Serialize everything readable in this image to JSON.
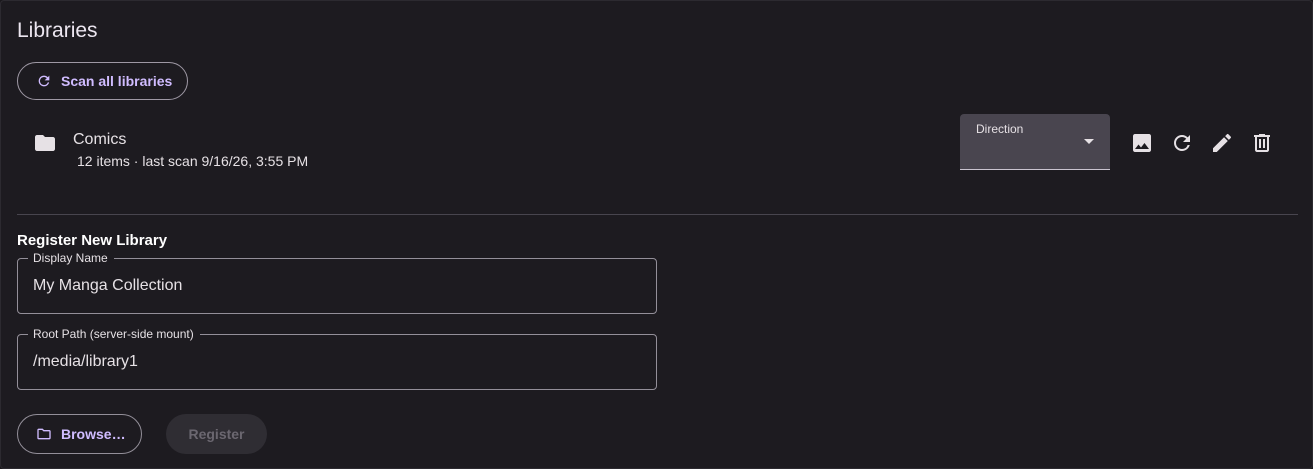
{
  "header": {
    "title": "Libraries"
  },
  "toolbar": {
    "scan_all_label": "Scan all libraries"
  },
  "libraries": [
    {
      "name": "Comics",
      "meta": "12 items · last scan 9/16/26, 3:55 PM",
      "direction_label": "Direction",
      "direction_value": "",
      "actions": [
        "image-icon",
        "refresh-icon",
        "edit-icon",
        "delete-icon"
      ]
    }
  ],
  "register": {
    "title": "Register New Library",
    "display_name": {
      "label": "Display Name",
      "value": "My Manga Collection"
    },
    "root_path": {
      "label": "Root Path (server-side mount)",
      "value": "/media/library1"
    },
    "browse_label": "Browse…",
    "register_label": "Register"
  },
  "colors": {
    "accent": "#d0bcff",
    "surface": "#1d1b20",
    "select_bg": "#49454f"
  }
}
